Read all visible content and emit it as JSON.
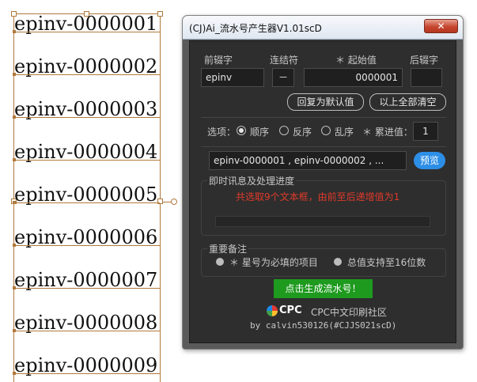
{
  "canvas": {
    "serials": [
      "epinv-0000001",
      "epinv-0000002",
      "epinv-0000003",
      "epinv-0000004",
      "epinv-0000005",
      "epinv-0000006",
      "epinv-0000007",
      "epinv-0000008",
      "epinv-0000009"
    ],
    "frame_color": "#b07a3c"
  },
  "window": {
    "title": "(CJ)Ai_流水号产生器V1.01scD",
    "close_label": "✕"
  },
  "fields": {
    "prefix_label": "前辍字",
    "connector_label": "连结符",
    "start_label": "＊ 起始值",
    "suffix_label": "后辍字",
    "prefix_value": "epinv",
    "connector_value": "－",
    "start_value": "0000001",
    "suffix_value": ""
  },
  "buttons": {
    "reset_default": "回复为默认值",
    "clear_all": "以上全部清空",
    "preview": "预览",
    "generate": "点击生成流水号！"
  },
  "options": {
    "label": "选项：",
    "ascending": "顺序",
    "descending": "反序",
    "random": "乱序",
    "step_label": "＊ 累进值：",
    "step_value": "1"
  },
  "preview_text": "epinv-0000001 , epinv-0000002 , ...",
  "progress": {
    "title": "即时讯息及处理进度",
    "message": "共选取9个文本框，由前至后递增值为1"
  },
  "notes": {
    "title": "重要备注",
    "required": "＊ 星号为必填的项目",
    "max_digits": "总值支持至16位数"
  },
  "footer": {
    "logo_text": "CPC",
    "community": "CPC中文印刷社区",
    "author": "by calvin530126(#CJJS021scD)"
  },
  "colors": {
    "accent_blue": "#2d8ee6",
    "generate_green": "#1e9a1e",
    "message_red": "#e03a2a"
  }
}
